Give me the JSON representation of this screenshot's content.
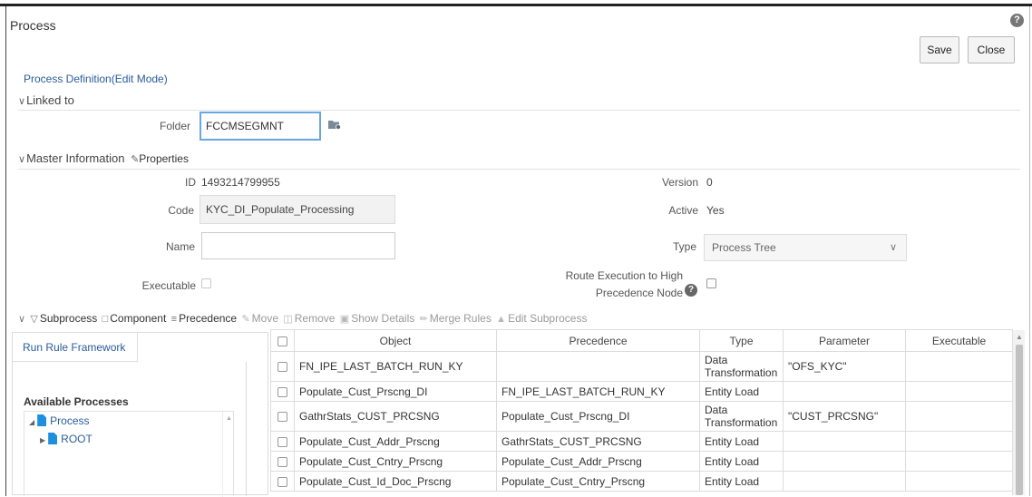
{
  "window": {
    "title": "Process",
    "help_glyph": "?"
  },
  "actions": {
    "save": "Save",
    "close": "Close"
  },
  "breadcrumb": "Process Definition(Edit Mode)",
  "linked_to": {
    "section_label": "Linked to",
    "folder_label": "Folder",
    "folder_value": "FCCMSEGMNT",
    "folder_icon": "folder-picker-icon"
  },
  "master": {
    "section_label": "Master Information",
    "properties_label": "Properties",
    "id_label": "ID",
    "id_value": "1493214799955",
    "version_label": "Version",
    "version_value": "0",
    "code_label": "Code",
    "code_value": "KYC_DI_Populate_Processing",
    "active_label": "Active",
    "active_value": "Yes",
    "name_label": "Name",
    "name_value": "",
    "type_label": "Type",
    "type_value": "Process Tree",
    "executable_label": "Executable",
    "route_label_line1": "Route Execution to High",
    "route_label_line2": "Precedence Node",
    "route_help_glyph": "?"
  },
  "toolbar": {
    "subprocess": "Subprocess",
    "component": "Component",
    "precedence": "Precedence",
    "move": "Move",
    "remove": "Remove",
    "show_details": "Show Details",
    "merge_rules": "Merge Rules",
    "edit_subprocess": "Edit Subprocess"
  },
  "left_panel": {
    "tab_label": "Run Rule Framework",
    "available_processes": "Available Processes",
    "tree": [
      {
        "label": "Process",
        "expanded": true
      },
      {
        "label": "ROOT",
        "expanded": false
      }
    ]
  },
  "grid": {
    "columns": [
      "Object",
      "Precedence",
      "Type",
      "Parameter",
      "Executable"
    ],
    "rows": [
      {
        "object": "FN_IPE_LAST_BATCH_RUN_KY",
        "precedence": "",
        "type": "Data Transformation",
        "parameter": "\"OFS_KYC\"",
        "executable": ""
      },
      {
        "object": "Populate_Cust_Prscng_DI",
        "precedence": "FN_IPE_LAST_BATCH_RUN_KY",
        "type": "Entity Load",
        "parameter": "",
        "executable": ""
      },
      {
        "object": "GathrStats_CUST_PRCSNG",
        "precedence": "Populate_Cust_Prscng_DI",
        "type": "Data Transformation",
        "parameter": "\"CUST_PRCSNG\"",
        "executable": ""
      },
      {
        "object": "Populate_Cust_Addr_Prscng",
        "precedence": "GathrStats_CUST_PRCSNG",
        "type": "Entity Load",
        "parameter": "",
        "executable": ""
      },
      {
        "object": "Populate_Cust_Cntry_Prscng",
        "precedence": "Populate_Cust_Addr_Prscng",
        "type": "Entity Load",
        "parameter": "",
        "executable": ""
      },
      {
        "object": "Populate_Cust_Id_Doc_Prscng",
        "precedence": "Populate_Cust_Cntry_Prscng",
        "type": "Entity Load",
        "parameter": "",
        "executable": ""
      }
    ]
  },
  "colors": {
    "accent": "#2a5d9a",
    "focus_border": "#6aa6e0",
    "tree_icon": "#1c8fe0"
  }
}
